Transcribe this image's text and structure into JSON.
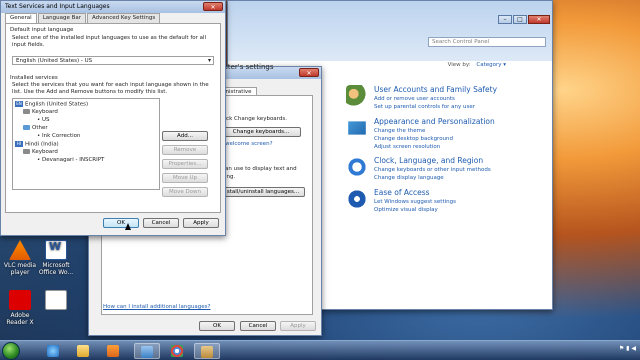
{
  "desktop": {
    "icons": [
      {
        "label": "VLC media player"
      },
      {
        "label": "Microsoft Office Wo..."
      },
      {
        "label": "Adobe Reader X"
      },
      {
        "label": ""
      }
    ]
  },
  "control_panel": {
    "search_placeholder": "Search Control Panel",
    "view_by_label": "View by:",
    "view_by_value": "Category ▾",
    "categories": [
      {
        "title": "User Accounts and Family Safety",
        "links": [
          "Add or remove user accounts",
          "Set up parental controls for any user"
        ]
      },
      {
        "title": "Appearance and Personalization",
        "links": [
          "Change the theme",
          "Change desktop background",
          "Adjust screen resolution"
        ]
      },
      {
        "title": "Clock, Language, and Region",
        "links": [
          "Change keyboards or other input methods",
          "Change display language"
        ]
      },
      {
        "title": "Ease of Access",
        "links": [
          "Let Windows suggest settings",
          "Optimize visual display"
        ]
      }
    ],
    "bottom_link": "How can I install additional languages?",
    "partial_title": "puter's settings"
  },
  "region_dialog": {
    "tab_partial": "inistrative",
    "text1": "lick Change keyboards.",
    "change_keyboards_button": "Change keyboards...",
    "welcome_link": "welcome screen?",
    "text2": "an use to display text and",
    "text3": "ing.",
    "install_button": "stall/uninstall languages...",
    "ok": "OK",
    "cancel": "Cancel",
    "apply": "Apply"
  },
  "text_services": {
    "title": "Text Services and Input Languages",
    "tabs": [
      "General",
      "Language Bar",
      "Advanced Key Settings"
    ],
    "default_group": "Default input language",
    "default_desc": "Select one of the installed input languages to use as the default for all input fields.",
    "default_value": "English (United States) - US",
    "installed_group": "Installed services",
    "installed_desc": "Select the services that you want for each input language shown in the list. Use the Add and Remove buttons to modify this list.",
    "tree": {
      "en_badge": "EN",
      "hi_badge": "HI",
      "en": "English (United States)",
      "keyboard": "Keyboard",
      "us": "US",
      "other": "Other",
      "ink": "Ink Correction",
      "hi": "Hindi (India)",
      "keyboard2": "Keyboard",
      "devanagari": "Devanagari - INSCRIPT"
    },
    "side_buttons": [
      "Add...",
      "Remove",
      "Properties...",
      "Move Up",
      "Move Down"
    ],
    "ok": "OK",
    "cancel": "Cancel",
    "apply": "Apply"
  },
  "taskbar": {
    "time": ""
  }
}
